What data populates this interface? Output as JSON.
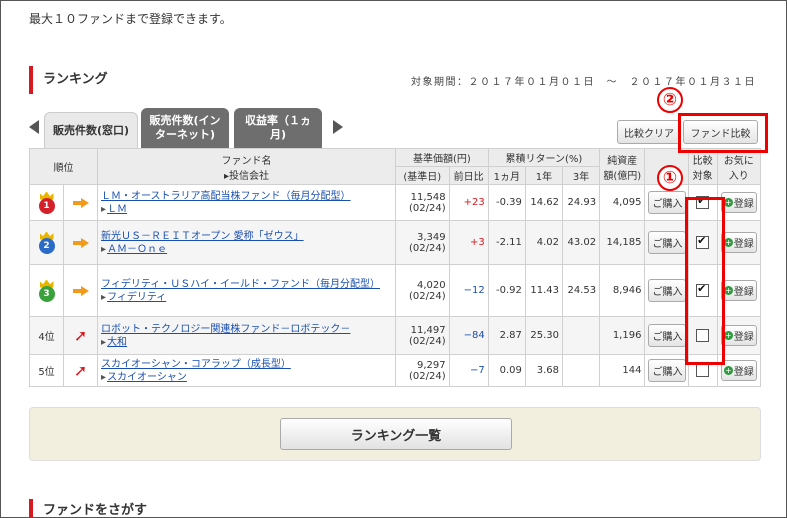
{
  "top_note": "最大１０ファンドまで登録できます。",
  "section": {
    "title": "ランキング",
    "period": "対象期間：２０１７年０１月０１日　～　２０１７年０１月３１日"
  },
  "tabs": [
    {
      "label": "販売件数(窓口)"
    },
    {
      "label": "販売件数(インターネット)"
    },
    {
      "label": "収益率（１ヵ月)"
    }
  ],
  "buttons": {
    "clear": "比較クリア",
    "compare": "ファンド比較",
    "more": "ランキング一覧"
  },
  "annotations": {
    "one": "①",
    "two": "②"
  },
  "headers": {
    "rank": "順位",
    "fund_name": "ファンド名",
    "company": "投信会社",
    "nav": "基準価額(円)",
    "nav_date": "(基準日)",
    "prev_day": "前日比",
    "cumulative": "累積リターン(%)",
    "m1": "1ヵ月",
    "y1": "1年",
    "y3": "3年",
    "assets": "純資産額(億円)",
    "compare": "比較対象",
    "fav": "お気に入り"
  },
  "rows": [
    {
      "rank": "1",
      "rank_label": "",
      "fund": "ＬＭ・オーストラリア高配当株ファンド（毎月分配型）",
      "company": "ＬＭ",
      "nav": "11,548",
      "date": "(02/24)",
      "change": "+23",
      "m1": "-0.39",
      "y1": "14.62",
      "y3": "24.93",
      "assets": "4,095",
      "buy": "ご購入",
      "fav": "登録",
      "checked": true,
      "crown_color": "#d4202a"
    },
    {
      "rank": "2",
      "rank_label": "",
      "fund": "新光ＵＳ－ＲＥＩＴオープン 愛称「ゼウス」",
      "company": "ＡＭ－Ｏｎｅ",
      "nav": "3,349",
      "date": "(02/24)",
      "change": "+3",
      "m1": "-2.11",
      "y1": "4.02",
      "y3": "43.02",
      "assets": "14,185",
      "buy": "ご購入",
      "fav": "登録",
      "checked": true,
      "crown_color": "#2a6bc8"
    },
    {
      "rank": "3",
      "rank_label": "",
      "fund": "フィデリティ・ＵＳハイ・イールド・ファンド（毎月分配型）",
      "company": "フィデリティ",
      "nav": "4,020",
      "date": "(02/24)",
      "change": "−12",
      "m1": "-0.92",
      "y1": "11.43",
      "y3": "24.53",
      "assets": "8,946",
      "buy": "ご購入",
      "fav": "登録",
      "checked": true,
      "crown_color": "#3aa23a"
    },
    {
      "rank": "",
      "rank_label": "4位",
      "fund": "ロボット・テクノロジー関連株ファンド－ロボテック－",
      "company": "大和",
      "nav": "11,497",
      "date": "(02/24)",
      "change": "−84",
      "m1": "2.87",
      "y1": "25.30",
      "y3": "",
      "assets": "1,196",
      "buy": "ご購入",
      "fav": "登録",
      "checked": false,
      "crown_color": ""
    },
    {
      "rank": "",
      "rank_label": "5位",
      "fund": "スカイオーシャン・コアラップ（成長型）",
      "company": "スカイオーシャン",
      "nav": "9,297",
      "date": "(02/24)",
      "change": "−7",
      "m1": "0.09",
      "y1": "3.68",
      "y3": "",
      "assets": "144",
      "buy": "ご購入",
      "fav": "登録",
      "checked": false,
      "crown_color": ""
    }
  ],
  "section2": {
    "title": "ファンドをさがす"
  },
  "colors": {
    "accent_red": "#d71920",
    "link_blue": "#1a4fb0"
  }
}
